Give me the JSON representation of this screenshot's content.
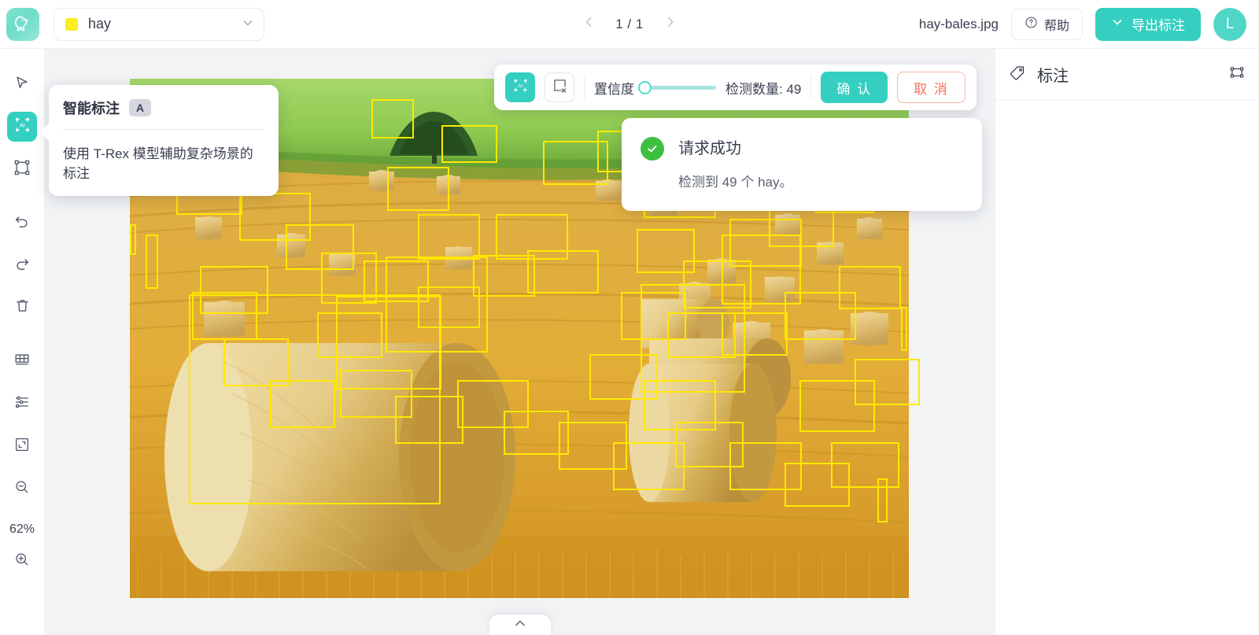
{
  "header": {
    "logo_icon": "trex-logo-icon",
    "class_select": {
      "value": "hay",
      "swatch_color": "#fcee21",
      "chevron_icon": "chevron-down-icon"
    },
    "pager": {
      "prev_icon": "chevron-left-icon",
      "next_icon": "chevron-right-icon",
      "label": "1 / 1"
    },
    "filename": "hay-bales.jpg",
    "help_button": {
      "label": "帮助",
      "icon": "question-circle-icon"
    },
    "export_button": {
      "label": "导出标注",
      "icon": "chevron-down-icon"
    },
    "avatar": {
      "initial": "L"
    }
  },
  "toolbar": {
    "items": [
      {
        "name": "select-cursor",
        "icon": "cursor-arrow-icon",
        "active": false
      },
      {
        "name": "ai-annotate",
        "icon": "ai-box-icon",
        "active": true
      },
      {
        "name": "bounding-box",
        "icon": "bounding-box-icon",
        "active": false
      },
      {
        "name": "undo",
        "icon": "undo-icon",
        "active": false
      },
      {
        "name": "redo",
        "icon": "redo-icon",
        "active": false
      },
      {
        "name": "delete",
        "icon": "trash-icon",
        "active": false
      },
      {
        "name": "grid",
        "icon": "grid-icon",
        "active": false
      },
      {
        "name": "settings",
        "icon": "sliders-icon",
        "active": false
      },
      {
        "name": "fit-screen",
        "icon": "fit-screen-icon",
        "active": false
      },
      {
        "name": "zoom-out",
        "icon": "zoom-out-icon",
        "active": false
      }
    ],
    "zoom_level": "62%",
    "zoom_in_icon": "zoom-in-icon"
  },
  "ai_toolbar": {
    "ai_tool_icon": "ai-add-box-icon",
    "clear_tool_icon": "box-remove-icon",
    "confidence_label": "置信度",
    "confidence_value": 0,
    "count_label": "检测数量: 49",
    "confirm_label": "确 认",
    "cancel_label": "取 消"
  },
  "toast": {
    "status_icon": "check-circle-icon",
    "title": "请求成功",
    "message": "检测到 49 个 hay。"
  },
  "hint": {
    "title": "智能标注",
    "shortcut": "A",
    "description": "使用 T-Rex 模型辅助复杂场景的标注"
  },
  "bottom_handle": {
    "icon": "chevron-up-icon"
  },
  "right_panel": {
    "title": "标注",
    "tag_icon": "tag-icon",
    "fit_icon": "bounding-box-icon",
    "items": []
  },
  "canvas": {
    "image_alt": "hay-bales field photo",
    "box_color": "#ffe800",
    "detections": [
      [
        31,
        4,
        13,
        18
      ],
      [
        40,
        9,
        17,
        17
      ],
      [
        60,
        10,
        20,
        19
      ],
      [
        66,
        18,
        22,
        21
      ],
      [
        2,
        30,
        4,
        25
      ],
      [
        6,
        17,
        20,
        22
      ],
      [
        14,
        22,
        22,
        22
      ],
      [
        20,
        28,
        21,
        21
      ],
      [
        33,
        17,
        19,
        20
      ],
      [
        37,
        26,
        19,
        21
      ],
      [
        53,
        12,
        20,
        20
      ],
      [
        47,
        26,
        22,
        21
      ],
      [
        30,
        35,
        20,
        19
      ],
      [
        37,
        40,
        19,
        19
      ],
      [
        44,
        34,
        19,
        19
      ],
      [
        51,
        33,
        22,
        20
      ],
      [
        65,
        29,
        18,
        20
      ],
      [
        71,
        35,
        21,
        22
      ],
      [
        77,
        27,
        22,
        22
      ],
      [
        82,
        24,
        20,
        20
      ],
      [
        88,
        18,
        18,
        19
      ],
      [
        92,
        10,
        17,
        17
      ],
      [
        63,
        41,
        20,
        22
      ],
      [
        69,
        45,
        21,
        21
      ],
      [
        76,
        45,
        20,
        20
      ],
      [
        84,
        41,
        22,
        22
      ],
      [
        91,
        36,
        19,
        20
      ],
      [
        9,
        36,
        21,
        22
      ],
      [
        24,
        45,
        20,
        21
      ],
      [
        59,
        53,
        21,
        21
      ],
      [
        66,
        58,
        22,
        23
      ],
      [
        86,
        58,
        23,
        24
      ],
      [
        93,
        54,
        20,
        21
      ],
      [
        8,
        41,
        20,
        22
      ],
      [
        99,
        44,
        2,
        20
      ],
      [
        0,
        28,
        2,
        14
      ],
      [
        27,
        56,
        22,
        22
      ],
      [
        34,
        61,
        21,
        22
      ],
      [
        42,
        58,
        22,
        22
      ],
      [
        48,
        64,
        20,
        20
      ],
      [
        55,
        66,
        21,
        22
      ],
      [
        62,
        70,
        22,
        22
      ],
      [
        70,
        66,
        21,
        21
      ],
      [
        77,
        70,
        22,
        22
      ],
      [
        84,
        74,
        20,
        20
      ],
      [
        90,
        70,
        21,
        21
      ],
      [
        96,
        77,
        3,
        20
      ],
      [
        12,
        50,
        20,
        22
      ],
      [
        18,
        58,
        20,
        22
      ]
    ]
  }
}
